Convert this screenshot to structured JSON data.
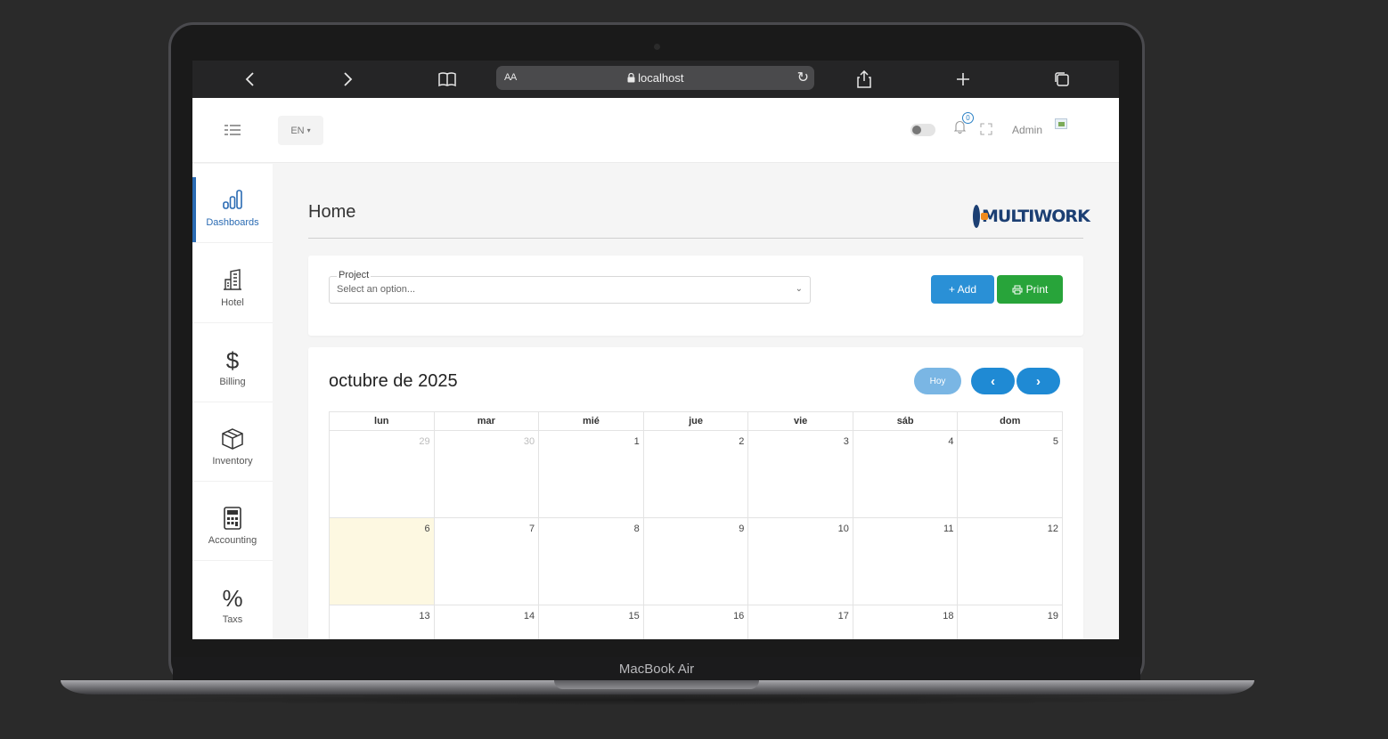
{
  "device": {
    "model_label": "MacBook Air"
  },
  "browser": {
    "url_size_label": "AA",
    "url": "localhost",
    "lock_glyph": "🔒"
  },
  "header": {
    "language": "EN",
    "notifications_count": "0",
    "user_name": "Admin"
  },
  "sidebar": {
    "items": [
      {
        "label": "Dashboards",
        "icon": "bar-chart-icon",
        "active": true
      },
      {
        "label": "Hotel",
        "icon": "building-icon"
      },
      {
        "label": "Billing",
        "icon": "dollar-icon"
      },
      {
        "label": "Inventory",
        "icon": "box-icon"
      },
      {
        "label": "Accounting",
        "icon": "calculator-icon"
      },
      {
        "label": "Taxs",
        "icon": "percent-icon"
      }
    ]
  },
  "page": {
    "title": "Home",
    "logo_text": "MULTIWORK"
  },
  "project_filter": {
    "legend": "Project",
    "placeholder": "Select an option...",
    "add_label": "+ Add",
    "print_label": "Print"
  },
  "calendar": {
    "title": "octubre de 2025",
    "today_label": "Hoy",
    "prev_label": "‹",
    "next_label": "›",
    "weekdays": [
      "lun",
      "mar",
      "mié",
      "jue",
      "vie",
      "sáb",
      "dom"
    ],
    "weeks": [
      [
        "29",
        "30",
        "1",
        "2",
        "3",
        "4",
        "5"
      ],
      [
        "6",
        "7",
        "8",
        "9",
        "10",
        "11",
        "12"
      ],
      [
        "13",
        "14",
        "15",
        "16",
        "17",
        "18",
        "19"
      ]
    ],
    "other_month_days": [
      "29",
      "30"
    ],
    "highlighted_day": "6"
  },
  "colors": {
    "primary": "#2a90d6",
    "success": "#28a43a",
    "active_nav": "#2a6bb3",
    "today_bg": "#fdf8e1"
  }
}
